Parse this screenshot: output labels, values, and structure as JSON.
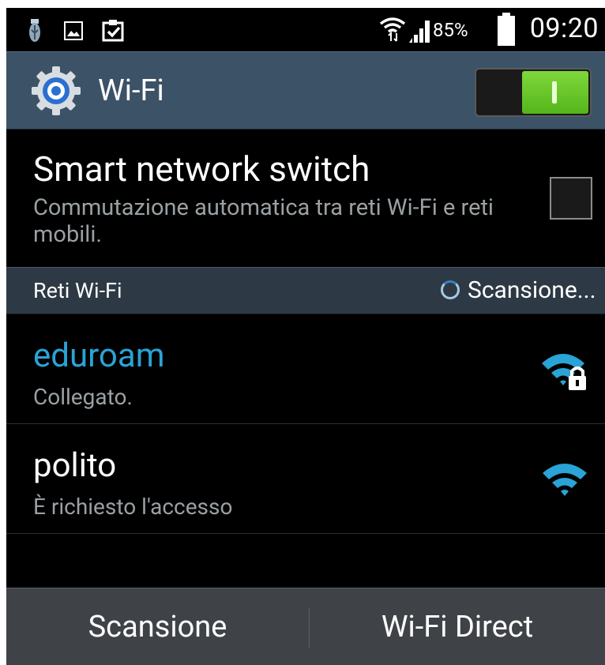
{
  "status_bar": {
    "time": "09:20",
    "battery_percent": "85%",
    "notification_icons": [
      "usb-icon",
      "image-icon",
      "clipboard-check-icon"
    ],
    "system_icons": [
      "wifi-data-icon",
      "signal-icon",
      "battery-icon"
    ]
  },
  "action_bar": {
    "title": "Wi-Fi",
    "icon": "settings-gear-icon",
    "toggle_state": "on"
  },
  "smart_network_switch": {
    "title": "Smart network switch",
    "description": "Commutazione automatica tra reti Wi-Fi e reti mobili.",
    "checked": false
  },
  "section": {
    "title": "Reti Wi-Fi",
    "scan_status": "Scansione..."
  },
  "networks": [
    {
      "name": "eduroam",
      "status": "Collegato.",
      "connected": true,
      "secured": true
    },
    {
      "name": "polito",
      "status": "È richiesto l'accesso",
      "connected": false,
      "secured": false
    }
  ],
  "bottom_bar": {
    "scan_label": "Scansione",
    "wifi_direct_label": "Wi-Fi Direct"
  },
  "colors": {
    "accent": "#2aa3d6",
    "action_bar_bg": "#3c5267",
    "toggle_on": "#6ccb2c",
    "section_bg": "#2d3a45",
    "bottom_bar_bg": "#3f4347"
  }
}
